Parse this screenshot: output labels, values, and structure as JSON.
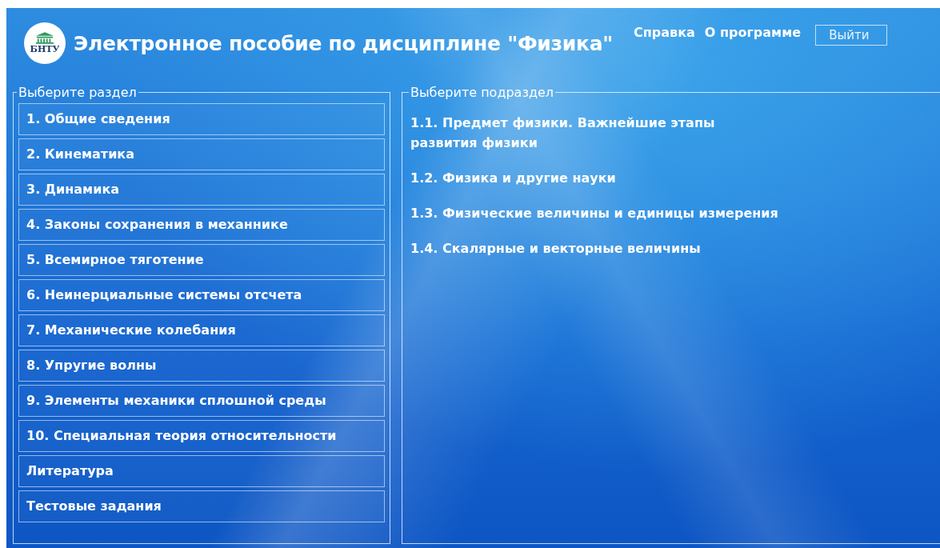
{
  "header": {
    "logo_text": "БНТУ",
    "title": "Электронное пособие по дисциплине \"Физика\"",
    "links": [
      "Справка",
      "О программе"
    ],
    "exit_button": "Выйти"
  },
  "sections": {
    "legend": "Выберите раздел",
    "items": [
      {
        "label": "1. Общие сведения"
      },
      {
        "label": "2. Кинематика"
      },
      {
        "label": "3. Динамика"
      },
      {
        "label": "4. Законы сохранения в механнике"
      },
      {
        "label": "5. Всемирное тяготение"
      },
      {
        "label": "6. Неинерциальные системы отсчета"
      },
      {
        "label": "7. Механические колебания"
      },
      {
        "label": "8. Упругие волны"
      },
      {
        "label": "9. Элементы механики сплошной среды"
      },
      {
        "label": "10. Специальная теория относительности"
      },
      {
        "label": "Литература"
      },
      {
        "label": "Тестовые задания"
      }
    ]
  },
  "subsections": {
    "legend": "Выберите подраздел",
    "items": [
      {
        "label": "1.1. Предмет физики. Важнейшие этапы развития физики"
      },
      {
        "label": "1.2. Физика и другие науки"
      },
      {
        "label": "1.3. Физические величины и единицы измерения"
      },
      {
        "label": "1.4. Скалярные и векторные величины"
      }
    ]
  }
}
